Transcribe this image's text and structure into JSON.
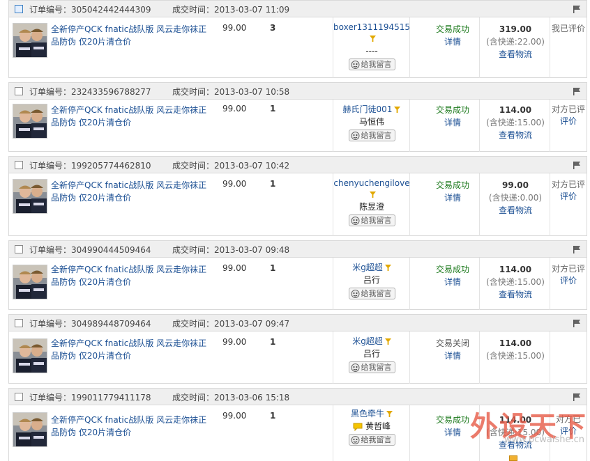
{
  "labels": {
    "order_no": "订单编号：",
    "deal_time": "成交时间：",
    "detail": "详情",
    "view_logistics": "查看物流",
    "leave_message": "给我留言"
  },
  "product_title": "全新停产QCK fnatic战队版 风云走你袜正品防伪 仅20片清仓价",
  "orders": [
    {
      "order_no": "305042442444309",
      "deal_time": "2013-03-07 11:09",
      "price": "99.00",
      "qty": "3",
      "buyer_name": "boxer1311194515",
      "buyer_real": "----",
      "status": "交易成功",
      "total": "319.00",
      "shipping": "(含快递:22.00)",
      "review": "我已评价",
      "review_link": ""
    },
    {
      "order_no": "232433596788277",
      "deal_time": "2013-03-07 10:58",
      "price": "99.00",
      "qty": "1",
      "buyer_name": "赫氏门徒001",
      "buyer_real": "马恒伟",
      "status": "交易成功",
      "total": "114.00",
      "shipping": "(含快递:15.00)",
      "review": "对方已评",
      "review_link": "评价"
    },
    {
      "order_no": "199205774462810",
      "deal_time": "2013-03-07 10:42",
      "price": "99.00",
      "qty": "1",
      "buyer_name": "chenyuchengilove",
      "buyer_real": "陈昱澄",
      "status": "交易成功",
      "total": "99.00",
      "shipping": "(含快递:0.00)",
      "review": "对方已评",
      "review_link": "评价"
    },
    {
      "order_no": "304990444509464",
      "deal_time": "2013-03-07 09:48",
      "price": "99.00",
      "qty": "1",
      "buyer_name": "米g超超",
      "buyer_real": "吕行",
      "status": "交易成功",
      "total": "114.00",
      "shipping": "(含快递:15.00)",
      "review": "对方已评",
      "review_link": "评价"
    },
    {
      "order_no": "304989448709464",
      "deal_time": "2013-03-07 09:47",
      "price": "99.00",
      "qty": "1",
      "buyer_name": "米g超超",
      "buyer_real": "吕行",
      "status": "交易关闭",
      "total": "114.00",
      "shipping": "(含快递:15.00)",
      "review": "",
      "review_link": ""
    },
    {
      "order_no": "199011779411178",
      "deal_time": "2013-03-06 15:18",
      "price": "99.00",
      "qty": "1",
      "buyer_name": "黑色牵牛",
      "buyer_real": "黄哲峰",
      "status": "交易成功",
      "total": "114.00",
      "shipping": "(含快递:15.00)",
      "review": "对方已",
      "review_link": "评价"
    }
  ],
  "watermark": {
    "main": "外设天下",
    "url": "www.pcwaishe.cn"
  },
  "colors": {
    "link": "#1b4f93",
    "success": "#1d7a1d",
    "header_bg": "#efefef"
  }
}
